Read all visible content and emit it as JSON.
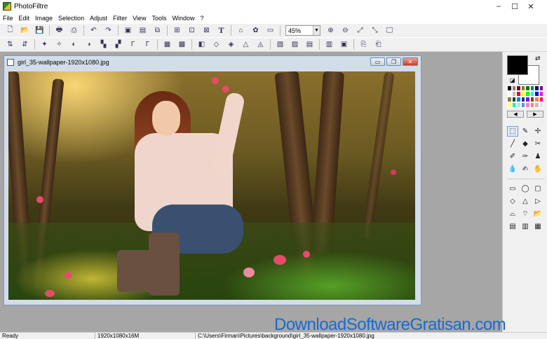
{
  "app": {
    "title": "PhotoFiltre",
    "window_controls": [
      "–",
      "☐",
      "✕"
    ]
  },
  "menu": [
    "File",
    "Edit",
    "Image",
    "Selection",
    "Adjust",
    "Filter",
    "View",
    "Tools",
    "Window",
    "?"
  ],
  "toolbar1": {
    "zoom_value": "45%",
    "buttons": [
      "new-icon",
      "open-icon",
      "save-icon",
      "print-icon",
      "scan-icon",
      "undo-icon",
      "redo-icon",
      "copy-layer-icon",
      "paste-icon",
      "crop-icon",
      "duplicate-icon",
      "image-size-icon",
      "canvas-size-icon",
      "text-icon",
      "browser-icon",
      "plugin-icon",
      "fullscreen-icon",
      "zoom-in-icon",
      "zoom-out-icon",
      "fit-icon",
      "actual-size-icon",
      "screen-icon"
    ],
    "glyphs": [
      "🗋",
      "📂",
      "💾",
      "🖶",
      "⎙",
      "↶",
      "↷",
      "▣",
      "▤",
      "⧉",
      "⊞",
      "⊡",
      "⊠",
      "T",
      "⌂",
      "✿",
      "▭",
      "⊕",
      "⊖",
      "⤢",
      "⤡",
      "🖵"
    ]
  },
  "toolbar2": {
    "glyphs": [
      "⇅",
      "⇵",
      "✦",
      "✧",
      "◐",
      "◑",
      "▚",
      "▞",
      "Γ",
      "Γ",
      "▦",
      "▩",
      "◧",
      "◇",
      "◈",
      "△",
      "◬",
      "▧",
      "▨",
      "▤",
      "▥",
      "▣",
      "⎘",
      "⎗"
    ]
  },
  "document": {
    "title": "girl_35-wallpaper-1920x1080.jpg",
    "controls": [
      "▭",
      "❐",
      "✕"
    ]
  },
  "palette": {
    "swap_label": "⇄",
    "reset_label": "◪",
    "nav": [
      "◀",
      "▶"
    ],
    "swatches": [
      "#000000",
      "#808080",
      "#800000",
      "#808000",
      "#008000",
      "#008080",
      "#000080",
      "#800080",
      "#ffffff",
      "#c0c0c0",
      "#ff0000",
      "#ffff00",
      "#00ff00",
      "#00ffff",
      "#0000ff",
      "#ff00ff",
      "#808040",
      "#004040",
      "#0080ff",
      "#004080",
      "#8000ff",
      "#804000",
      "#ff8040",
      "#ff0080",
      "#ffff80",
      "#00ff80",
      "#80ffff",
      "#8080ff",
      "#ff80c0",
      "#ff8080",
      "#c0c0c0",
      "#e0e0e0"
    ]
  },
  "tools": {
    "glyphs": [
      "⬚",
      "✎",
      "✢",
      "╱",
      "◆",
      "✂",
      "✐",
      "✑",
      "♟",
      "💧",
      "✍",
      "✋",
      "▭",
      "◯",
      "▢",
      "◇",
      "△",
      "▷",
      "⌓",
      "⌔",
      "📂",
      "▤",
      "▥",
      "▦"
    ]
  },
  "statusbar": {
    "state": "Ready",
    "dimensions": "1920x1080x16M",
    "path": "C:\\Users\\Firman\\Pictures\\background\\girl_35-wallpaper-1920x1080.jpg"
  },
  "watermark": "DownloadSoftwareGratisan.com"
}
